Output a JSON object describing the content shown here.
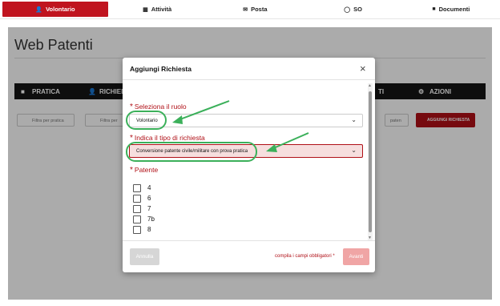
{
  "nav": {
    "tabs": [
      {
        "label": "Volontario",
        "icon": "user-icon"
      },
      {
        "label": "Attività",
        "icon": "calendar-icon"
      },
      {
        "label": "Posta",
        "icon": "envelope-icon"
      },
      {
        "label": "SO",
        "icon": "clock-icon"
      },
      {
        "label": "Documenti",
        "icon": "folder-icon"
      }
    ]
  },
  "page": {
    "title": "Web Patenti",
    "bar": {
      "pratica": "PRATICA",
      "richiedi": "RICHIED",
      "ti": "TI",
      "azioni": "AZIONI"
    },
    "filters": {
      "pratica": "Filtra per pratica",
      "filtra": "Filtra per",
      "paten": "paten"
    },
    "add_button": "AGGIUNGI RICHIESTA"
  },
  "modal": {
    "title": "Aggiungi Richiesta",
    "close": "×",
    "role_label": "Seleziona il ruolo",
    "role_value": "Volontario",
    "type_label": "Indica il tipo di richiesta",
    "type_value": "Conversione patente civile/militare con prova pratica",
    "patente_label": "Patente",
    "patenti": [
      "4",
      "6",
      "7",
      "7b",
      "8"
    ],
    "cancel": "Annulla",
    "required_note": "compila i campi obbligatori *",
    "next": "Avanti"
  },
  "colors": {
    "brand_red": "#c0141f",
    "annotation_green": "#3bb05a"
  }
}
